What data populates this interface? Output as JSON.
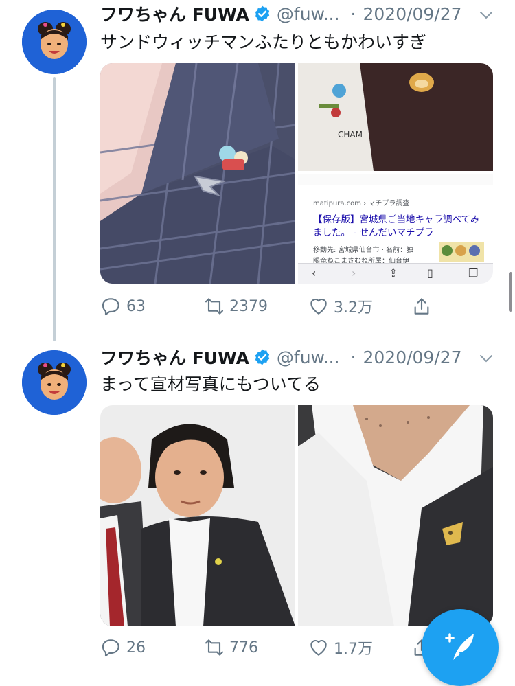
{
  "tweets": [
    {
      "display_name": "フワちゃん FUWA",
      "handle": "@fuw...",
      "separator": "·",
      "date": "2020/09/27",
      "text": "サンドウィッチマンふたりともかわいすぎ",
      "replies": "63",
      "retweets": "2379",
      "likes": "3.2万"
    },
    {
      "display_name": "フワちゃん FUWA",
      "handle": "@fuw...",
      "separator": "·",
      "date": "2020/09/27",
      "text": "まって宣材写真にもついてる",
      "replies": "26",
      "retweets": "776",
      "likes": "1.7万"
    }
  ],
  "image_texts": {
    "shirt_print": "CHAM",
    "screenshot_site": "matipura.com › マチプラ調査",
    "screenshot_title": "【保存版】宮城県ご当地キャラ調べてみました。 - せんだいマチプラ",
    "screenshot_snippet_1": "移動先: 宮城県仙台市 · 名前：独",
    "screenshot_snippet_2": "眼竜ねこまさむね所属：仙台伊"
  },
  "colors": {
    "accent": "#1da1f2",
    "verified": "#1da1f2",
    "avatar_bg": "#1f62d6",
    "secondary_text": "#657786"
  },
  "icons": [
    "verified-badge-icon",
    "chevron-down-icon",
    "reply-icon",
    "retweet-icon",
    "like-icon",
    "share-icon",
    "compose-tweet-icon"
  ]
}
